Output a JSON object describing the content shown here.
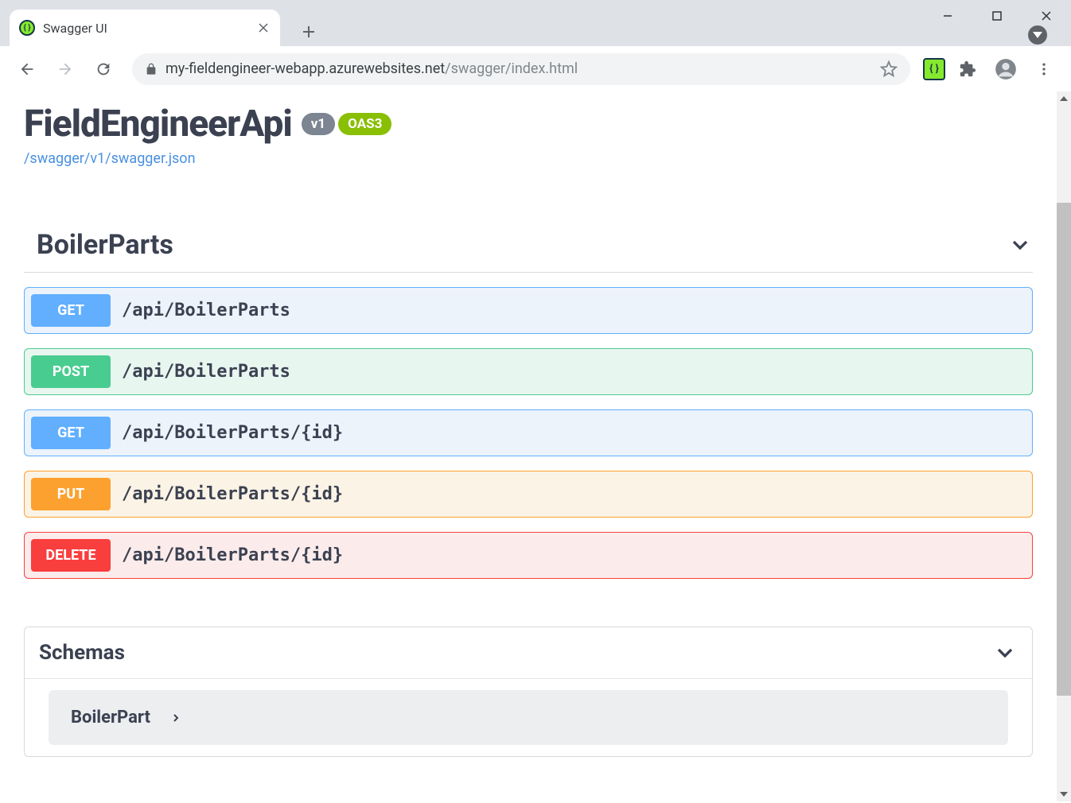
{
  "browser": {
    "tab_title": "Swagger UI",
    "url_host": "my-fieldengineer-webapp.azurewebsites.net",
    "url_path": "/swagger/index.html"
  },
  "header": {
    "title": "FieldEngineerApi",
    "version_badge": "v1",
    "oas_badge": "OAS3",
    "json_link": "/swagger/v1/swagger.json"
  },
  "tag": {
    "name": "BoilerParts"
  },
  "operations": [
    {
      "method": "GET",
      "path": "/api/BoilerParts",
      "cls": "opblock-get"
    },
    {
      "method": "POST",
      "path": "/api/BoilerParts",
      "cls": "opblock-post"
    },
    {
      "method": "GET",
      "path": "/api/BoilerParts/{id}",
      "cls": "opblock-get"
    },
    {
      "method": "PUT",
      "path": "/api/BoilerParts/{id}",
      "cls": "opblock-put"
    },
    {
      "method": "DELETE",
      "path": "/api/BoilerParts/{id}",
      "cls": "opblock-delete"
    }
  ],
  "schemas_label": "Schemas",
  "schemas": [
    {
      "name": "BoilerPart"
    }
  ]
}
